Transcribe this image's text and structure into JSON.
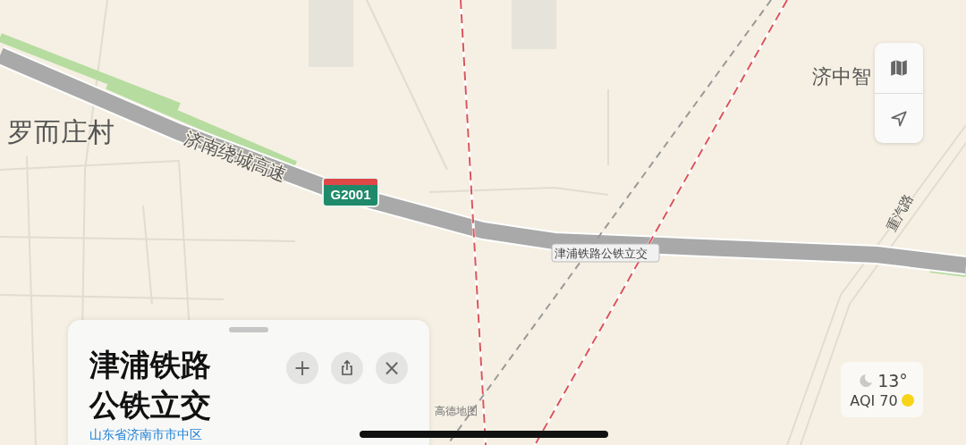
{
  "map": {
    "labels": [
      {
        "kind": "place",
        "text": "罗而庄村"
      },
      {
        "kind": "road",
        "text": "济南绕城高速"
      },
      {
        "kind": "place",
        "text": "济中智"
      },
      {
        "kind": "road",
        "text": "重汽路"
      },
      {
        "kind": "junction",
        "text": "津浦铁路公铁立交"
      },
      {
        "kind": "attribution",
        "text": "高德地图"
      }
    ],
    "shield": {
      "text": "G2001"
    }
  },
  "controls": [
    {
      "kind": "map-mode"
    },
    {
      "kind": "locate"
    }
  ],
  "weather": {
    "temperature": "13°",
    "aqi": "AQI 70",
    "aqi_dot": {
      "color": "#f7d417"
    }
  },
  "sheet": {
    "title_lines": [
      "津浦铁路",
      "公铁立交"
    ],
    "subtitle": "山东省济南市市中区",
    "actions": [
      "+",
      "×"
    ]
  }
}
